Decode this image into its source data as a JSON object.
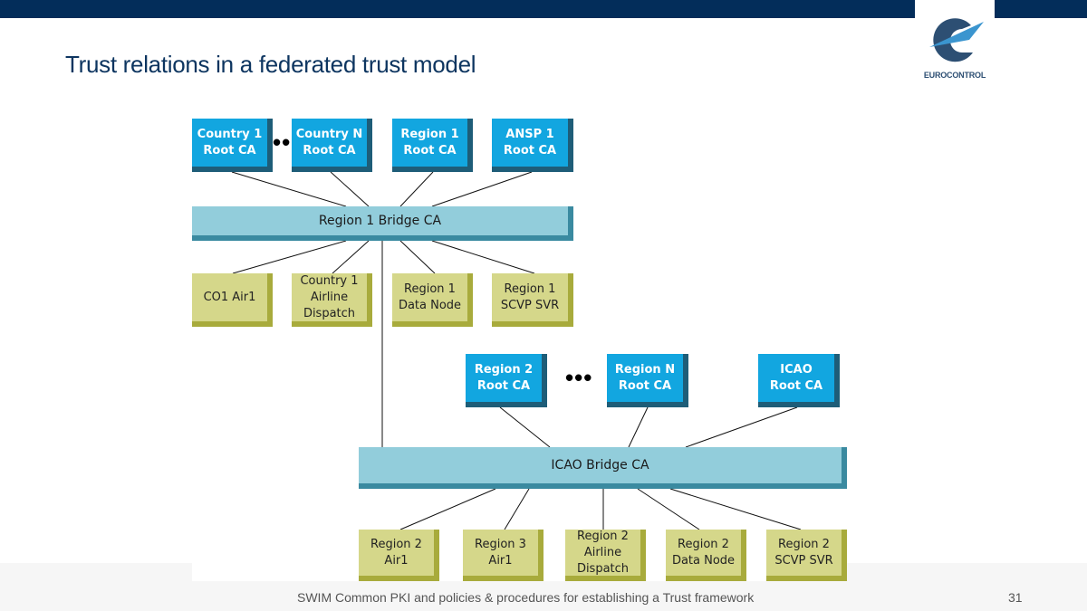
{
  "slide": {
    "title": "Trust relations in a federated trust model",
    "logo_text": "EUROCONTROL",
    "footer_text": "SWIM Common PKI and policies & procedures for establishing a Trust framework",
    "page_number": "31",
    "colors": {
      "top_bar": "#032d5a",
      "root_ca": "#12a6e0",
      "bridge_ca": "#92cddb",
      "leaf_node": "#d5d78a"
    }
  },
  "diagram": {
    "region1": {
      "roots": [
        {
          "label": "Country 1\nRoot CA"
        },
        {
          "label": "Country N\nRoot CA"
        },
        {
          "label": "Region 1\nRoot CA"
        },
        {
          "label": "ANSP 1\nRoot CA"
        }
      ],
      "ellipsis": "•••",
      "bridge": "Region 1 Bridge CA",
      "leaves": [
        {
          "label": "CO1 Air1"
        },
        {
          "label": "Country 1\nAirline\nDispatch"
        },
        {
          "label": "Region 1\nData Node"
        },
        {
          "label": "Region 1\nSCVP SVR"
        }
      ]
    },
    "icao": {
      "roots": [
        {
          "label": "Region 2\nRoot CA"
        },
        {
          "label": "Region N\nRoot CA"
        },
        {
          "label": "ICAO\nRoot CA"
        }
      ],
      "ellipsis": "•••",
      "bridge": "ICAO Bridge CA",
      "leaves": [
        {
          "label": "Region 2\nAir1"
        },
        {
          "label": "Region 3\nAir1"
        },
        {
          "label": "Region 2\nAirline\nDispatch"
        },
        {
          "label": "Region 2\nData Node"
        },
        {
          "label": "Region 2\nSCVP SVR"
        }
      ]
    },
    "links": [
      "Country 1 Root CA - Region 1 Bridge CA",
      "Country N Root CA - Region 1 Bridge CA",
      "Region 1 Root CA - Region 1 Bridge CA",
      "ANSP 1 Root CA - Region 1 Bridge CA",
      "Region 1 Bridge CA - CO1 Air1",
      "Region 1 Bridge CA - Country 1 Airline Dispatch",
      "Region 1 Bridge CA - Region 1 Data Node",
      "Region 1 Bridge CA - Region 1 SCVP SVR",
      "Region 1 Bridge CA - ICAO Bridge CA",
      "Region 2 Root CA - ICAO Bridge CA",
      "Region N Root CA - ICAO Bridge CA",
      "ICAO Root CA - ICAO Bridge CA",
      "ICAO Bridge CA - Region 2 Air1",
      "ICAO Bridge CA - Region 3 Air1",
      "ICAO Bridge CA - Region 2 Airline Dispatch",
      "ICAO Bridge CA - Region 2 Data Node",
      "ICAO Bridge CA - Region 2 SCVP SVR"
    ]
  }
}
